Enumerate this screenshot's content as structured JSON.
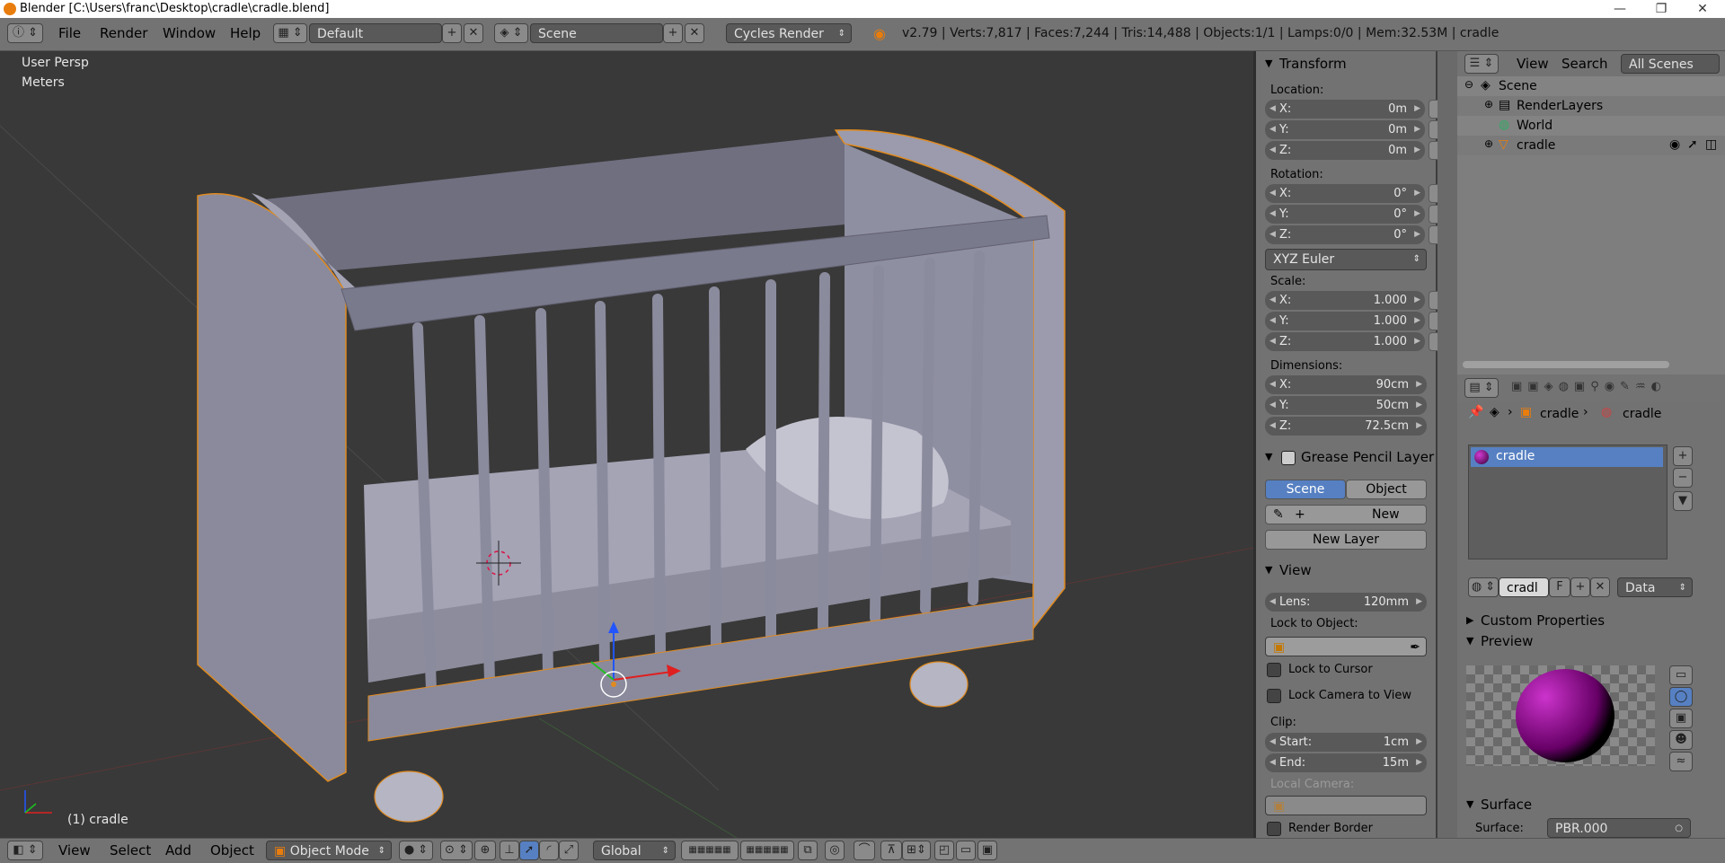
{
  "window": {
    "title": "Blender [C:\\Users\\franc\\Desktop\\cradle\\cradle.blend]",
    "minimize": "—",
    "maximize": "❐",
    "close": "✕"
  },
  "topbar": {
    "menus": [
      "File",
      "Render",
      "Window",
      "Help"
    ],
    "screen_layout": "Default",
    "scene": "Scene",
    "render_engine": "Cycles Render",
    "stats": "v2.79 | Verts:7,817 | Faces:7,244 | Tris:14,488 | Objects:1/1 | Lamps:0/0 | Mem:32.53M | cradle"
  },
  "viewport": {
    "view_name": "User Persp",
    "units": "Meters",
    "object_label": "(1) cradle"
  },
  "transform": {
    "header": "Transform",
    "location_label": "Location:",
    "location": [
      {
        "k": "X:",
        "v": "0m"
      },
      {
        "k": "Y:",
        "v": "0m"
      },
      {
        "k": "Z:",
        "v": "0m"
      }
    ],
    "rotation_label": "Rotation:",
    "rotation": [
      {
        "k": "X:",
        "v": "0°"
      },
      {
        "k": "Y:",
        "v": "0°"
      },
      {
        "k": "Z:",
        "v": "0°"
      }
    ],
    "rotation_mode": "XYZ Euler",
    "scale_label": "Scale:",
    "scale": [
      {
        "k": "X:",
        "v": "1.000"
      },
      {
        "k": "Y:",
        "v": "1.000"
      },
      {
        "k": "Z:",
        "v": "1.000"
      }
    ],
    "dimensions_label": "Dimensions:",
    "dimensions": [
      {
        "k": "X:",
        "v": "90cm"
      },
      {
        "k": "Y:",
        "v": "50cm"
      },
      {
        "k": "Z:",
        "v": "72.5cm"
      }
    ]
  },
  "grease_pencil": {
    "header": "Grease Pencil Layer",
    "tab_scene": "Scene",
    "tab_object": "Object",
    "new_label": "New",
    "new_layer_label": "New Layer"
  },
  "view_panel": {
    "header": "View",
    "lens_label": "Lens:",
    "lens_value": "120mm",
    "lock_to_object": "Lock to Object:",
    "lock_to_cursor": "Lock to Cursor",
    "lock_camera": "Lock Camera to View",
    "clip_label": "Clip:",
    "clip_start_label": "Start:",
    "clip_start": "1cm",
    "clip_end_label": "End:",
    "clip_end": "15m",
    "local_camera": "Local Camera:",
    "render_border": "Render Border"
  },
  "outliner": {
    "view_label": "View",
    "search_label": "Search",
    "filter": "All Scenes",
    "items": [
      "Scene",
      "RenderLayers",
      "World",
      "cradle"
    ]
  },
  "properties": {
    "breadcrumb_object": "cradle",
    "breadcrumb_material": "cradle",
    "material_slot": "cradle",
    "material_name": "cradl",
    "fake_user": "F",
    "link_type": "Data",
    "custom_properties": "Custom Properties",
    "preview": "Preview",
    "surface_header": "Surface",
    "surface_label": "Surface:",
    "surface_value": "PBR.000"
  },
  "bottombar": {
    "menus": [
      "View",
      "Select",
      "Add",
      "Object"
    ],
    "mode": "Object Mode",
    "orientation": "Global"
  },
  "colors": {
    "selection_outline": "#e08a1e",
    "accent_blue": "#5680c2",
    "mesh_color": "#8e8ea0"
  }
}
